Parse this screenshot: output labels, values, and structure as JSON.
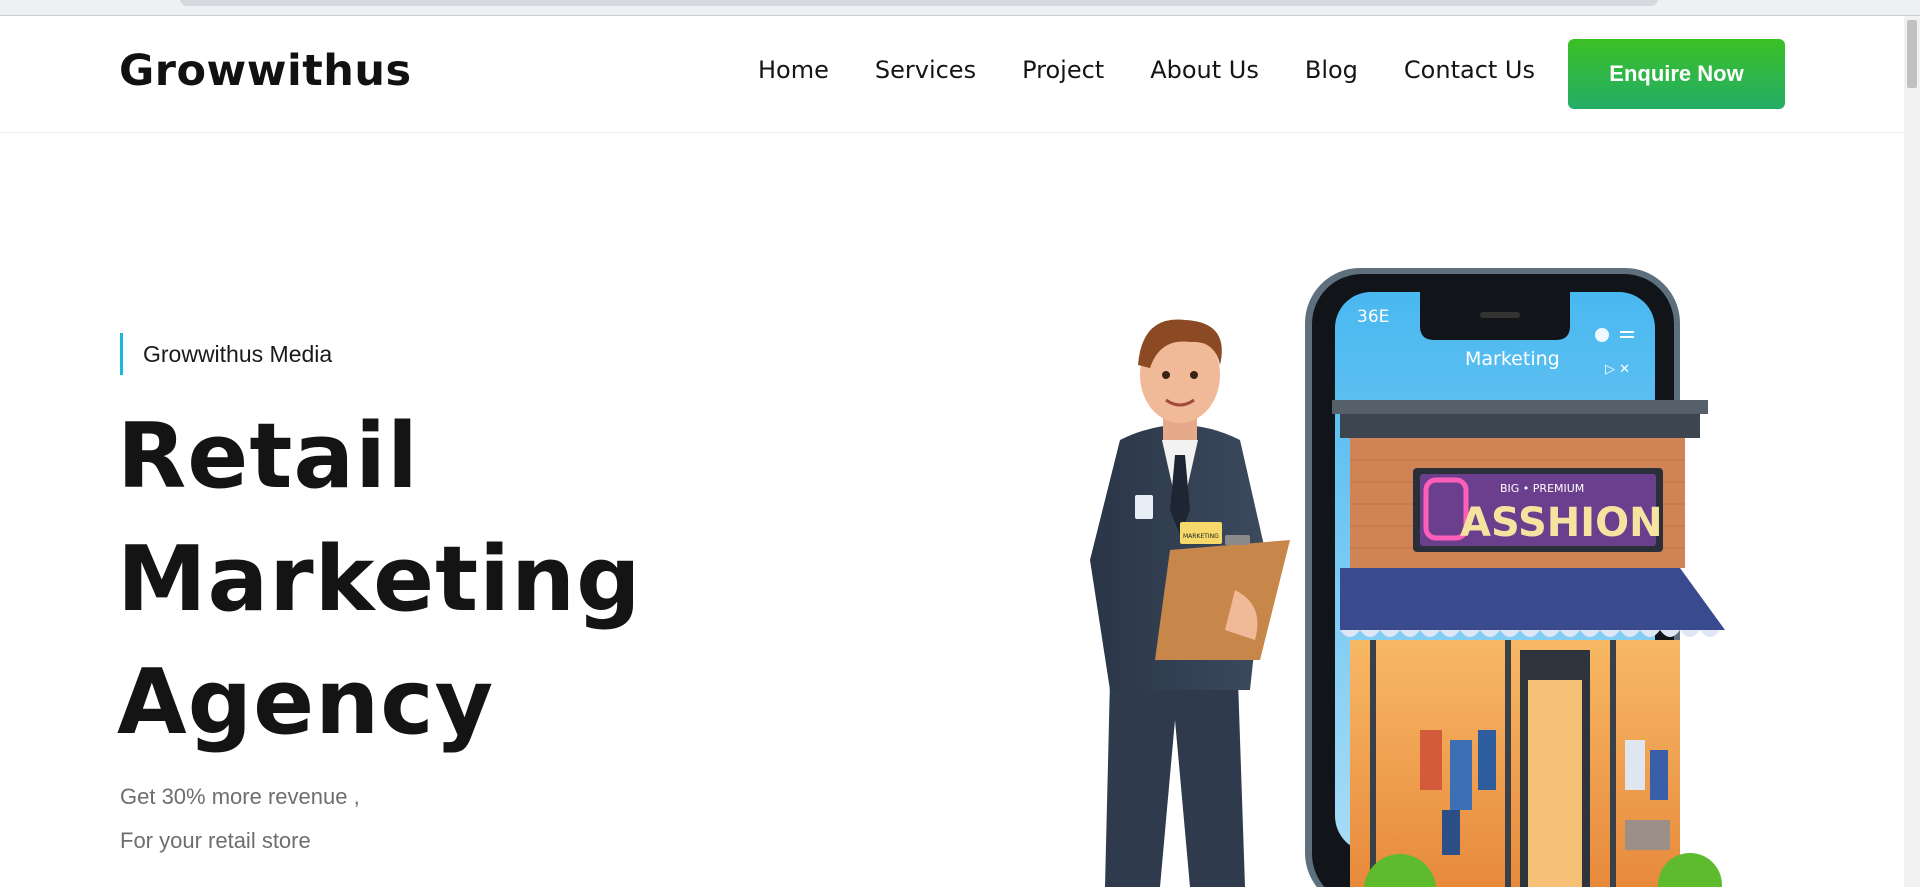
{
  "header": {
    "logo": "Growwithus",
    "nav": [
      "Home",
      "Services",
      "Project",
      "About Us",
      "Blog",
      "Contact Us"
    ],
    "cta": "Enquire Now"
  },
  "hero": {
    "eyebrow": "Growwithus Media",
    "headline": [
      "Retail",
      "Marketing",
      "Agency"
    ],
    "sub": [
      "Get 30% more revenue ,",
      "For your retail store"
    ]
  },
  "illustration": {
    "phone_status": "36E",
    "phone_label": "Marketing",
    "store_banner": "BIG • PREMIUM",
    "store_sign": "ASSHION",
    "badge_text": "MARKETING"
  },
  "colors": {
    "accent_green_top": "#3bc026",
    "accent_green_bottom": "#24ad67",
    "eyebrow_bar": "#19b7d8",
    "text_dark": "#141414",
    "text_muted": "#6e6e6e"
  }
}
